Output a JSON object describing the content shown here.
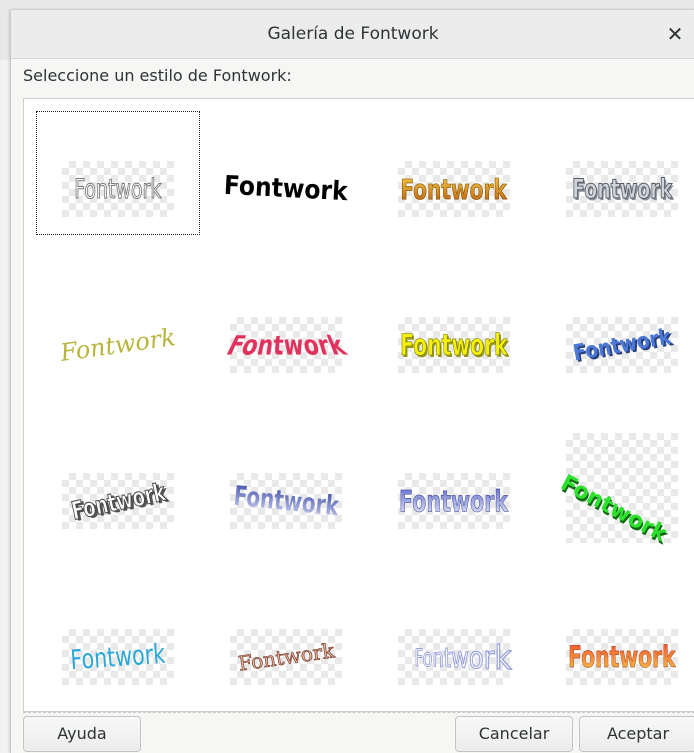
{
  "dialog": {
    "title": "Galería de Fontwork",
    "close_icon": "close-icon",
    "prompt": "Seleccione un estilo de Fontwork:"
  },
  "gallery": {
    "selected_index": 0,
    "items": [
      {
        "label": "Fontwork",
        "style": "outline-white"
      },
      {
        "label": "Fontwork",
        "style": "arc-black"
      },
      {
        "label": "Fontwork",
        "style": "gold-gradient"
      },
      {
        "label": "Fontwork",
        "style": "silver-3d"
      },
      {
        "label": "Fontwork",
        "style": "olive-italic-slant"
      },
      {
        "label": "Fontwork",
        "style": "red-perspective"
      },
      {
        "label": "Fontwork",
        "style": "yellow-3d"
      },
      {
        "label": "Fontwork",
        "style": "blue-wave-3d"
      },
      {
        "label": "Fontwork",
        "style": "gray-slant-3d"
      },
      {
        "label": "Fontwork",
        "style": "navy-gradient-wave"
      },
      {
        "label": "Fontwork",
        "style": "periwinkle-bulge"
      },
      {
        "label": "Fontwork",
        "style": "green-arc-3d"
      },
      {
        "label": "Fontwork",
        "style": "cyan-wave"
      },
      {
        "label": "Fontwork",
        "style": "brown-arch"
      },
      {
        "label": "Fontwork",
        "style": "lavender-perspective"
      },
      {
        "label": "Fontwork",
        "style": "orange-red-gradient"
      }
    ]
  },
  "buttons": {
    "help": "Ayuda",
    "cancel": "Cancelar",
    "ok": "Aceptar"
  },
  "colors": {
    "dialog_bg": "#f6f6f5",
    "gallery_bg": "#ffffff",
    "text": "#2e3436"
  }
}
